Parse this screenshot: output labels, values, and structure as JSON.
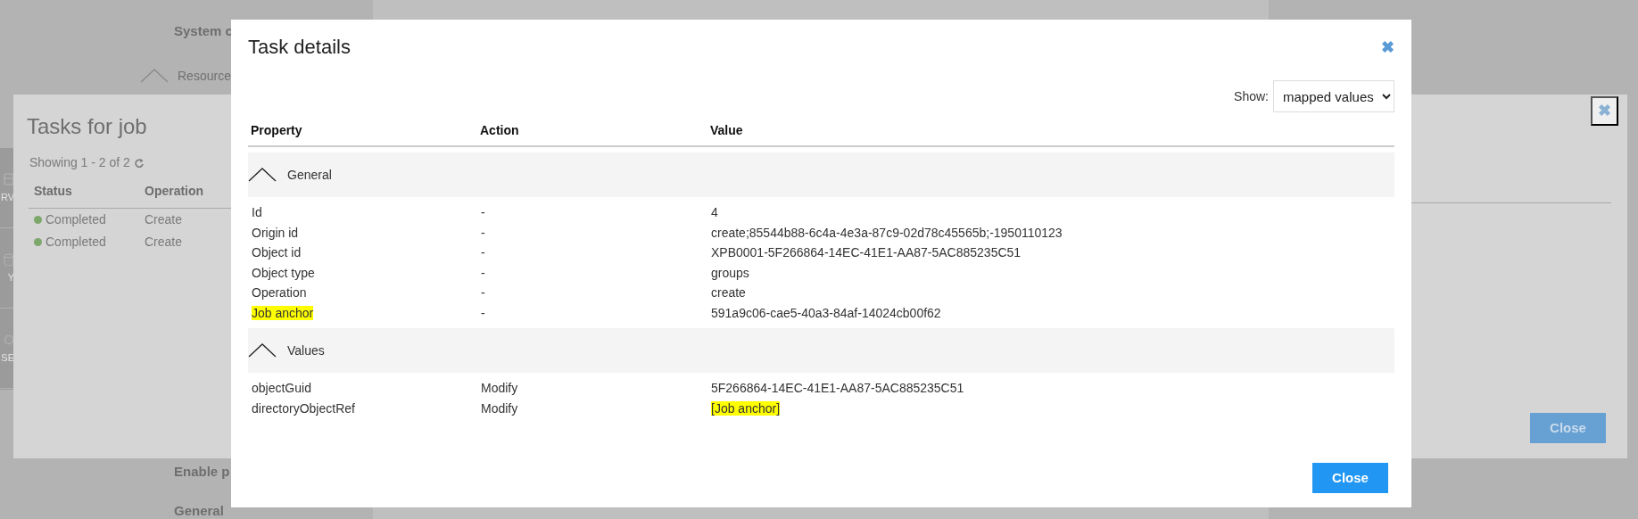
{
  "background_page": {
    "top_heading": "System c",
    "section": {
      "label": "Resource",
      "expanded": true
    },
    "lower_headings": [
      "Enable p",
      "General"
    ]
  },
  "sidebar": {
    "items": [
      {
        "label": "RV",
        "kind": "server"
      },
      {
        "label": "Y",
        "kind": "database"
      },
      {
        "label": "SE",
        "kind": "gear"
      }
    ]
  },
  "tasks_dialog": {
    "title": "Tasks for job",
    "showing": "Showing 1 - 2 of 2",
    "columns": [
      "Status",
      "Operation"
    ],
    "rows": [
      {
        "status": "Completed",
        "operation": "Create"
      },
      {
        "status": "Completed",
        "operation": "Create"
      }
    ],
    "close_icon": "✖",
    "close_button": "Close"
  },
  "task_details": {
    "title": "Task details",
    "close_icon": "✖",
    "show": {
      "label": "Show:",
      "value": "mapped values"
    },
    "columns": [
      "Property",
      "Action",
      "Value"
    ],
    "groups": [
      {
        "label": "General",
        "expanded": true,
        "rows": [
          {
            "property": "Id",
            "action": "-",
            "value": "4",
            "property_highlighted": false,
            "value_highlighted": false
          },
          {
            "property": "Origin id",
            "action": "-",
            "value": "create;85544b88-6c4a-4e3a-87c9-02d78c45565b;-1950110123",
            "property_highlighted": false,
            "value_highlighted": false
          },
          {
            "property": "Object id",
            "action": "-",
            "value": "XPB0001-5F266864-14EC-41E1-AA87-5AC885235C51",
            "property_highlighted": false,
            "value_highlighted": false
          },
          {
            "property": "Object type",
            "action": "-",
            "value": "groups",
            "property_highlighted": false,
            "value_highlighted": false
          },
          {
            "property": "Operation",
            "action": "-",
            "value": "create",
            "property_highlighted": false,
            "value_highlighted": false
          },
          {
            "property": "Job anchor",
            "action": "-",
            "value": "591a9c06-cae5-40a3-84af-14024cb00f62",
            "property_highlighted": true,
            "value_highlighted": false
          }
        ]
      },
      {
        "label": "Values",
        "expanded": true,
        "rows": [
          {
            "property": "objectGuid",
            "action": "Modify",
            "value": "5F266864-14EC-41E1-AA87-5AC885235C51",
            "property_highlighted": false,
            "value_highlighted": false
          },
          {
            "property": "directoryObjectRef",
            "action": "Modify",
            "value": "[Job anchor]",
            "property_highlighted": false,
            "value_highlighted": true
          }
        ]
      }
    ],
    "close_button": "Close"
  }
}
